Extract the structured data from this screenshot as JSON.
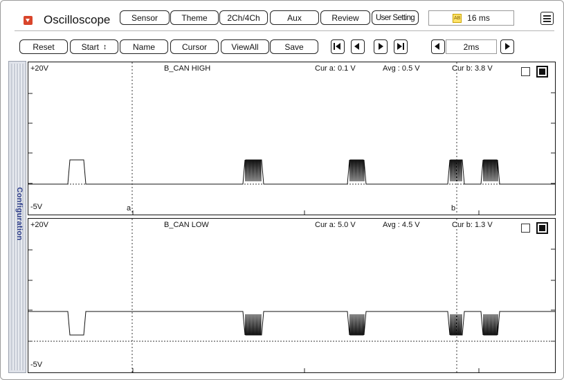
{
  "app": {
    "title": "Oscilloscope",
    "time_display": "16 ms",
    "time_icon_glyph": "AB"
  },
  "toolbar_top": [
    {
      "id": "sensor",
      "label": "Sensor"
    },
    {
      "id": "theme",
      "label": "Theme"
    },
    {
      "id": "2ch-4ch",
      "label": "2Ch/4Ch"
    },
    {
      "id": "aux",
      "label": "Aux"
    },
    {
      "id": "review",
      "label": "Review"
    },
    {
      "id": "user-setting",
      "label": "User Setting"
    }
  ],
  "toolbar_bottom": {
    "reset": "Reset",
    "start": "Start",
    "start_arrows": "↕",
    "name": "Name",
    "cursor": "Cursor",
    "viewall": "ViewAll",
    "save": "Save"
  },
  "timebase": "2ms",
  "sidebar": {
    "label": "Configuration"
  },
  "channels": [
    {
      "name": "B_CAN HIGH",
      "top_label": "+20V",
      "bottom_label": "-5V",
      "cur_a": "Cur a: 0.1 V",
      "avg": "Avg  : 0.5 V",
      "cur_b": "Cur b: 3.8 V",
      "cursor_a_label": "a",
      "cursor_b_label": "b"
    },
    {
      "name": "B_CAN LOW",
      "top_label": "+20V",
      "bottom_label": "-5V",
      "cur_a": "Cur a: 5.0 V",
      "avg": "Avg  : 4.5 V",
      "cur_b": "Cur b: 1.3 V"
    }
  ],
  "colors": {
    "trace": "#111111",
    "grid": "#222222",
    "accent": "#d9452b"
  }
}
